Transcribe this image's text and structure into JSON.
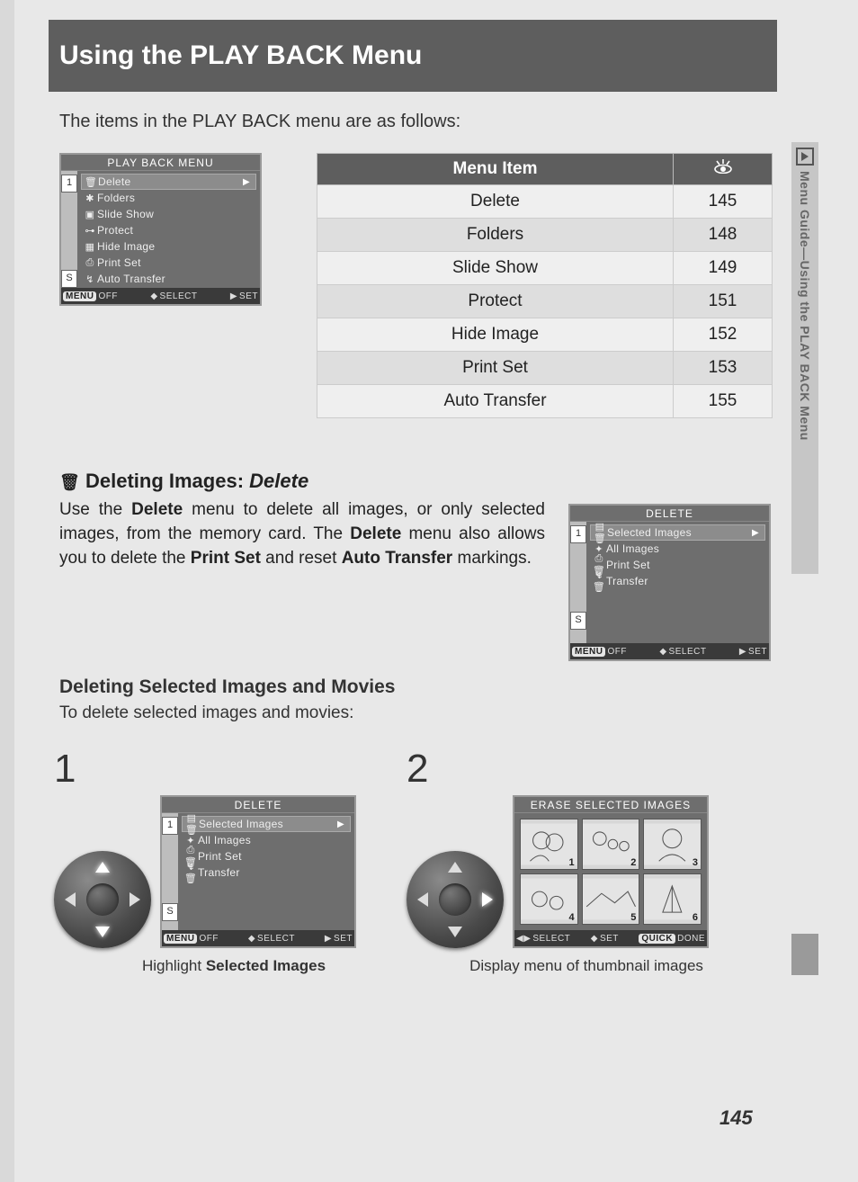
{
  "title": "Using the PLAY BACK Menu",
  "intro": "The items in the PLAY BACK menu are as follows:",
  "playback_menu_lcd": {
    "title": "PLAY BACK MENU",
    "tabs": [
      "1",
      "S"
    ],
    "items": [
      {
        "icon": "trash",
        "label": "Delete",
        "highlight": true,
        "arrow": true
      },
      {
        "icon": "star",
        "label": "Folders"
      },
      {
        "icon": "slides",
        "label": "Slide Show"
      },
      {
        "icon": "key",
        "label": "Protect"
      },
      {
        "icon": "hide",
        "label": "Hide Image"
      },
      {
        "icon": "print",
        "label": "Print Set"
      },
      {
        "icon": "xfer",
        "label": "Auto Transfer"
      }
    ],
    "footer": {
      "menu": "MENU",
      "off": "OFF",
      "select": "SELECT",
      "set": "SET"
    }
  },
  "spec_table": {
    "headers": {
      "item": "Menu Item",
      "page_icon": "eye"
    },
    "rows": [
      {
        "item": "Delete",
        "page": "145"
      },
      {
        "item": "Folders",
        "page": "148"
      },
      {
        "item": "Slide Show",
        "page": "149"
      },
      {
        "item": "Protect",
        "page": "151"
      },
      {
        "item": "Hide Image",
        "page": "152"
      },
      {
        "item": "Print Set",
        "page": "153"
      },
      {
        "item": "Auto Transfer",
        "page": "155"
      }
    ]
  },
  "delete_section": {
    "heading_prefix": "Deleting Images:",
    "heading_em": "Delete",
    "para_parts": {
      "t1": "Use the ",
      "b1": "Delete",
      "t2": " menu to delete all images, or only selected images, from the memory card. The ",
      "b2": "Delete",
      "t3": " menu also allows you to delete the ",
      "b3": "Print Set",
      "t4": " and reset ",
      "b4": "Auto Transfer",
      "t5": " markings."
    }
  },
  "delete_lcd": {
    "title": "DELETE",
    "tabs": [
      "1",
      "S"
    ],
    "items": [
      {
        "icon": "sel",
        "label": "Selected Images",
        "highlight": true,
        "arrow": true
      },
      {
        "icon": "all",
        "label": "All Images"
      },
      {
        "icon": "print",
        "label": "Print Set"
      },
      {
        "icon": "xfer",
        "label": "Transfer"
      }
    ],
    "footer": {
      "menu": "MENU",
      "off": "OFF",
      "select": "SELECT",
      "set": "SET"
    }
  },
  "selected_h3": "Deleting Selected Images and Movies",
  "selected_sub": "To delete selected images and movies:",
  "steps": {
    "s1": {
      "num": "1",
      "caption_pre": "Highlight ",
      "caption_bold": "Selected Images"
    },
    "s2": {
      "num": "2",
      "caption": "Display menu of thumbnail images"
    }
  },
  "erase_lcd": {
    "title": "ERASE SELECTED IMAGES",
    "thumbnails": [
      "1",
      "2",
      "3",
      "4",
      "5",
      "6"
    ],
    "footer": {
      "select": "SELECT",
      "set": "SET",
      "quick": "QUICK",
      "done": "DONE"
    }
  },
  "side_tab": "Menu Guide—Using the PLAY BACK Menu",
  "page_number": "145"
}
